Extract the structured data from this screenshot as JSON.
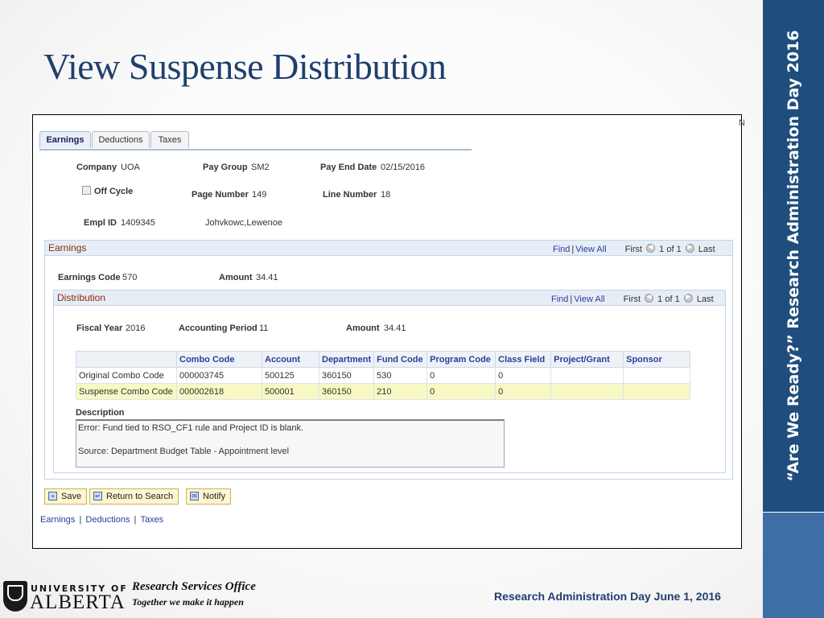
{
  "slide": {
    "title": "View Suspense Distribution",
    "side_banner": "“Are We Ready?” Research Administration Day 2016",
    "footer_office": "Research Services Office",
    "footer_tagline": "Together we make it happen",
    "footer_right": "Research Administration Day June 1, 2016",
    "logo_line1": "UNIVERSITY OF",
    "logo_line2": "ALBERTA"
  },
  "app": {
    "corner_mark": "N",
    "tabs": [
      "Earnings",
      "Deductions",
      "Taxes"
    ],
    "active_tab": "Earnings",
    "header": {
      "company_label": "Company",
      "company_value": "UOA",
      "pay_group_label": "Pay Group",
      "pay_group_value": "SM2",
      "pay_end_date_label": "Pay End Date",
      "pay_end_date_value": "02/15/2016",
      "off_cycle_label": "Off Cycle",
      "page_number_label": "Page Number",
      "page_number_value": "149",
      "line_number_label": "Line Number",
      "line_number_value": "18",
      "empl_id_label": "Empl ID",
      "empl_id_value": "1409345",
      "employee_name": "Johvkowc,Lewenoe"
    },
    "earnings": {
      "title": "Earnings",
      "nav": {
        "find": "Find",
        "view_all": "View All",
        "first": "First",
        "count": "1 of 1",
        "last": "Last"
      },
      "earnings_code_label": "Earnings Code",
      "earnings_code_value": "570",
      "amount_label": "Amount",
      "amount_value": "34.41"
    },
    "distribution": {
      "title": "Distribution",
      "nav": {
        "find": "Find",
        "view_all": "View All",
        "first": "First",
        "count": "1 of 1",
        "last": "Last"
      },
      "fiscal_year_label": "Fiscal Year",
      "fiscal_year_value": "2016",
      "accounting_period_label": "Accounting Period",
      "accounting_period_value": "11",
      "amount_label": "Amount",
      "amount_value": "34.41",
      "columns": [
        "",
        "Combo Code",
        "Account",
        "Department",
        "Fund Code",
        "Program Code",
        "Class Field",
        "Project/Grant",
        "Sponsor"
      ],
      "rows": [
        [
          "Original Combo Code",
          "000003745",
          "500125",
          "360150",
          "530",
          "0",
          "0",
          "",
          ""
        ],
        [
          "Suspense Combo Code",
          "000002618",
          "500001",
          "360150",
          "210",
          "0",
          "0",
          "",
          ""
        ]
      ],
      "description_label": "Description",
      "description_line1": "Error: Fund tied to RSO_CF1 rule and Project ID is blank.",
      "description_line2": "Source: Department Budget Table - Appointment level"
    },
    "buttons": {
      "save": "Save",
      "return": "Return to Search",
      "notify": "Notify"
    },
    "bottom_links": [
      "Earnings",
      "Deductions",
      "Taxes"
    ]
  }
}
